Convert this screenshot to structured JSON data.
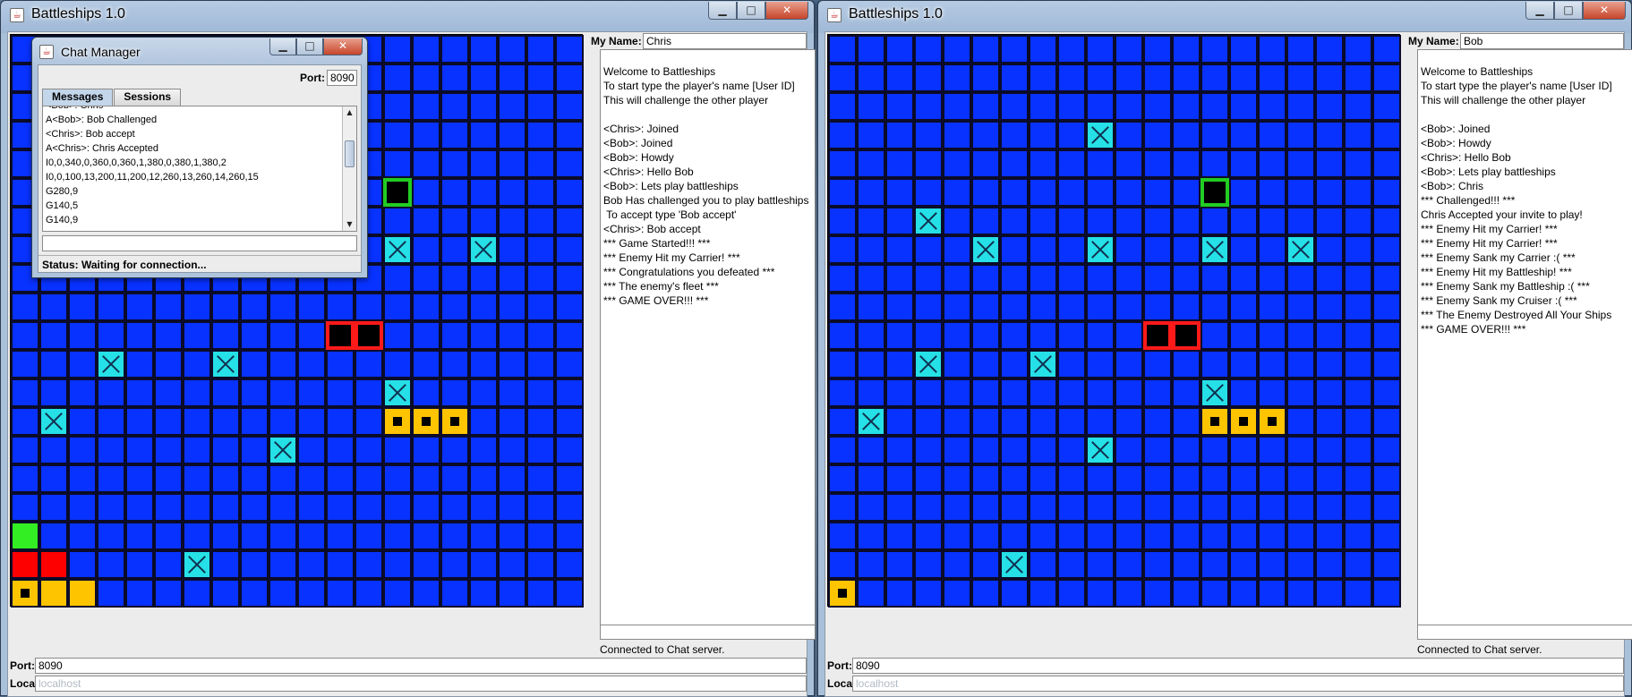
{
  "window_left": {
    "title": "Battleships 1.0",
    "my_name_label": "My Name:",
    "my_name_value": "Chris",
    "log": [
      "Welcome to Battleships",
      "To start type the player's name [User ID]",
      "This will challenge the other player",
      "",
      "<Chris>: Joined",
      "<Bob>: Joined",
      "<Bob>: Howdy",
      "<Chris>: Hello Bob",
      "<Bob>: Lets play battleships",
      "Bob Has challenged you to play battleships",
      " To accept type 'Bob accept'",
      "<Chris>: Bob accept",
      "*** Game Started!!! ***",
      "*** Enemy Hit my Carrier! ***",
      "*** Congratulations you defeated ***",
      "*** The enemy's fleet ***",
      "*** GAME OVER!!! ***"
    ],
    "message_input": "",
    "connection_status": "Connected to Chat server.",
    "port_label": "Port:",
    "port_value": "8090",
    "location_label": "Location:",
    "location_value": "localhost",
    "board": {
      "rows": 20,
      "cols": 20,
      "marks": [
        {
          "r": 5,
          "c": 13,
          "kind": "target"
        },
        {
          "r": 7,
          "c": 13,
          "kind": "miss"
        },
        {
          "r": 7,
          "c": 16,
          "kind": "miss"
        },
        {
          "r": 10,
          "c": 11,
          "kind": "hit"
        },
        {
          "r": 10,
          "c": 12,
          "kind": "hit"
        },
        {
          "r": 11,
          "c": 3,
          "kind": "miss"
        },
        {
          "r": 11,
          "c": 7,
          "kind": "miss"
        },
        {
          "r": 12,
          "c": 13,
          "kind": "miss"
        },
        {
          "r": 13,
          "c": 1,
          "kind": "miss"
        },
        {
          "r": 13,
          "c": 13,
          "kind": "ship"
        },
        {
          "r": 13,
          "c": 14,
          "kind": "ship"
        },
        {
          "r": 13,
          "c": 15,
          "kind": "ship"
        },
        {
          "r": 14,
          "c": 9,
          "kind": "miss"
        },
        {
          "r": 17,
          "c": 0,
          "kind": "shipgreen"
        },
        {
          "r": 18,
          "c": 0,
          "kind": "shipred"
        },
        {
          "r": 18,
          "c": 1,
          "kind": "shipred"
        },
        {
          "r": 18,
          "c": 6,
          "kind": "miss"
        },
        {
          "r": 19,
          "c": 0,
          "kind": "ship"
        },
        {
          "r": 19,
          "c": 1,
          "kind": "shipplain"
        },
        {
          "r": 19,
          "c": 2,
          "kind": "shipplain"
        }
      ]
    }
  },
  "window_right": {
    "title": "Battleships 1.0",
    "my_name_label": "My Name:",
    "my_name_value": "Bob",
    "log": [
      "Welcome to Battleships",
      "To start type the player's name [User ID]",
      "This will challenge the other player",
      "",
      "<Bob>: Joined",
      "<Bob>: Howdy",
      "<Chris>: Hello Bob",
      "<Bob>: Lets play battleships",
      "<Bob>: Chris",
      "*** Challenged!!! ***",
      "Chris Accepted your invite to play!",
      "*** Enemy Hit my Carrier! ***",
      "*** Enemy Hit my Carrier! ***",
      "*** Enemy Sank my Carrier :( ***",
      "*** Enemy Hit my Battleship! ***",
      "*** Enemy Sank my Battleship :( ***",
      "*** Enemy Sank my Cruiser :( ***",
      "*** The Enemy Destroyed All Your Ships",
      "*** GAME OVER!!! ***"
    ],
    "message_input": "",
    "connection_status": "Connected to Chat server.",
    "port_label": "Port:",
    "port_value": "8090",
    "location_label": "Location:",
    "location_value": "localhost",
    "board": {
      "rows": 20,
      "cols": 20,
      "marks": [
        {
          "r": 3,
          "c": 9,
          "kind": "miss"
        },
        {
          "r": 5,
          "c": 13,
          "kind": "target"
        },
        {
          "r": 6,
          "c": 3,
          "kind": "miss"
        },
        {
          "r": 7,
          "c": 5,
          "kind": "miss"
        },
        {
          "r": 7,
          "c": 9,
          "kind": "miss"
        },
        {
          "r": 7,
          "c": 13,
          "kind": "miss"
        },
        {
          "r": 7,
          "c": 16,
          "kind": "miss"
        },
        {
          "r": 10,
          "c": 11,
          "kind": "hit"
        },
        {
          "r": 10,
          "c": 12,
          "kind": "hit"
        },
        {
          "r": 11,
          "c": 3,
          "kind": "miss"
        },
        {
          "r": 11,
          "c": 7,
          "kind": "miss"
        },
        {
          "r": 12,
          "c": 13,
          "kind": "miss"
        },
        {
          "r": 13,
          "c": 1,
          "kind": "miss"
        },
        {
          "r": 13,
          "c": 13,
          "kind": "ship"
        },
        {
          "r": 13,
          "c": 14,
          "kind": "ship"
        },
        {
          "r": 13,
          "c": 15,
          "kind": "ship"
        },
        {
          "r": 14,
          "c": 9,
          "kind": "miss"
        },
        {
          "r": 18,
          "c": 6,
          "kind": "miss"
        },
        {
          "r": 19,
          "c": 0,
          "kind": "ship"
        }
      ]
    }
  },
  "chat_manager": {
    "title": "Chat Manager",
    "port_label": "Port:",
    "port_value": "8090",
    "tabs": [
      "Messages",
      "Sessions"
    ],
    "messages": [
      "<Bob>: Chris",
      "A<Bob>: Bob Challenged",
      "<Chris>: Bob accept",
      "A<Chris>: Chris Accepted",
      "I0,0,340,0,360,0,360,1,380,0,380,1,380,2",
      "I0,0,100,13,200,11,200,12,260,13,260,14,260,15",
      "G280,9",
      "G140,5",
      "G140,9"
    ],
    "input_value": "",
    "status": "Status: Waiting for connection..."
  },
  "icons": {
    "minimize": "minimize-icon",
    "maximize": "maximize-icon",
    "close": "close-icon",
    "app": "java-app-icon"
  },
  "colors": {
    "water": "#0832ff",
    "grid_line": "#0b0b2a",
    "miss": "#25e0e6",
    "hit_border": "#ff1a1a",
    "ship": "#ffc400",
    "ship_red": "#ff0000",
    "ship_green": "#33ee22",
    "target_border": "#22cc22"
  }
}
